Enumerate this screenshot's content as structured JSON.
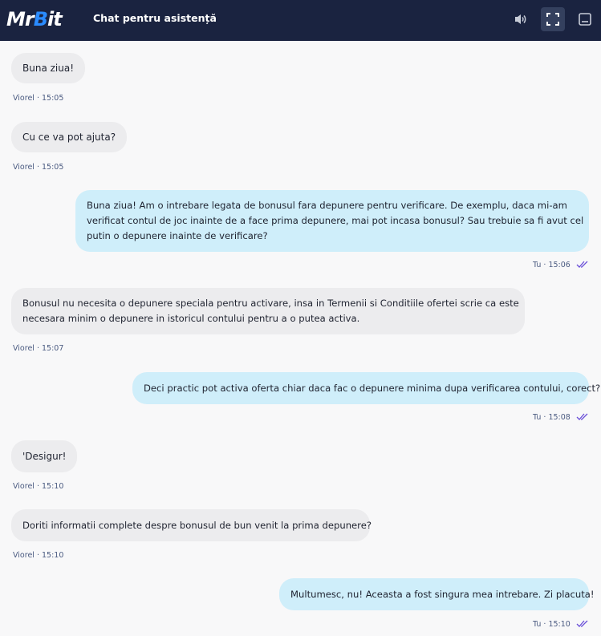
{
  "header": {
    "logo_prefix": "Mr",
    "logo_b": "B",
    "logo_suffix": "it",
    "title": "Chat pentru asistență",
    "bg_color": "#1a2340",
    "accent": "#2a8bff"
  },
  "messages": [
    {
      "from": "agent",
      "text": "Buna ziua!",
      "meta": "Viorel · 15:05"
    },
    {
      "from": "agent",
      "text": "Cu ce va pot ajuta?",
      "meta": "Viorel · 15:05"
    },
    {
      "from": "user",
      "lines": [
        "Buna ziua! Am o intrebare legata de bonusul fara depunere pentru verificare. De exemplu, daca mi-am",
        "verificat contul de joc inainte de a face prima depunere, mai pot incasa bonusul? Sau trebuie sa fi avut cel",
        "putin o depunere inainte de verificare?"
      ],
      "meta": "Tu · 15:06"
    },
    {
      "from": "agent",
      "lines": [
        "Bonusul nu necesita o depunere speciala pentru activare, insa in Termenii si Conditiile ofertei scrie ca este",
        "necesara minim o depunere in istoricul contului pentru a o putea activa."
      ],
      "meta": "Viorel · 15:07"
    },
    {
      "from": "user",
      "text": "Deci practic pot activa oferta chiar daca fac o depunere minima dupa verificarea contului, corect?",
      "meta": "Tu · 15:08"
    },
    {
      "from": "agent",
      "text": "'Desigur!",
      "meta": "Viorel · 15:10"
    },
    {
      "from": "agent",
      "text": "Doriti informatii complete despre bonusul de bun venit la prima depunere?",
      "meta": "Viorel · 15:10"
    },
    {
      "from": "user",
      "text": "Multumesc, nu! Aceasta a fost singura mea intrebare. Zi placuta!",
      "meta": "Tu · 15:10"
    }
  ],
  "colors": {
    "agent_bubble": "#ececee",
    "user_bubble": "#cfeefa",
    "read_tick": "#6a4fd8"
  }
}
